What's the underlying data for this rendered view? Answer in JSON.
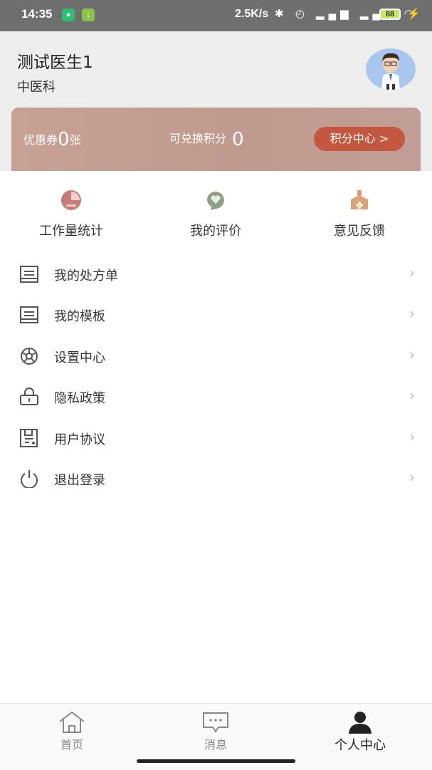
{
  "status_bar": {
    "time": "14:35",
    "speed": "2.5K/s",
    "indicators": "✱ ◴ ▂▄▆ ▂▄▆ ◠",
    "battery": "88",
    "charge_icon": "bolt-icon"
  },
  "profile": {
    "doctor_name": "测试医生1",
    "department": "中医科",
    "avatar_icon": "doctor-avatar"
  },
  "points": {
    "coupon_prefix": "优惠券",
    "coupon_count": "0",
    "coupon_suffix": "张",
    "exchangeable_label": "可兑换积分",
    "exchangeable_value": "0",
    "center_button": "积分中心 >"
  },
  "quick_actions": [
    {
      "label": "工作量统计",
      "icon": "pie-chart-icon",
      "color": "#c77b78"
    },
    {
      "label": "我的评价",
      "icon": "heart-bubble-icon",
      "color": "#8f9f86"
    },
    {
      "label": "意见反馈",
      "icon": "feedback-house-icon",
      "color": "#d7a47a"
    }
  ],
  "menu": [
    {
      "label": "我的处方单",
      "icon": "document-icon"
    },
    {
      "label": "我的模板",
      "icon": "template-icon"
    },
    {
      "label": "设置中心",
      "icon": "settings-wheel-icon"
    },
    {
      "label": "隐私政策",
      "icon": "lock-icon"
    },
    {
      "label": "用户协议",
      "icon": "agreement-icon"
    },
    {
      "label": "退出登录",
      "icon": "power-icon"
    }
  ],
  "tabs": [
    {
      "label": "首页",
      "icon": "home-icon",
      "active": false
    },
    {
      "label": "消息",
      "icon": "message-icon",
      "active": false
    },
    {
      "label": "个人中心",
      "icon": "person-icon",
      "active": true
    }
  ],
  "colors": {
    "card_gradient_start": "#c8a195",
    "points_button": "#c4573f",
    "header_bg": "#eeeeee"
  }
}
